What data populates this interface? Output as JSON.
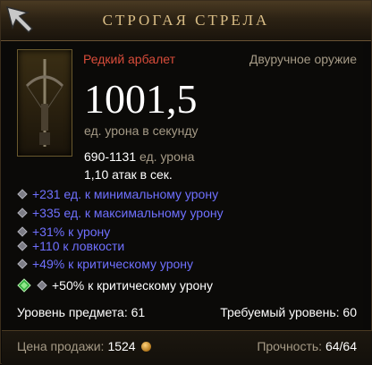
{
  "header": {
    "title": "СТРОГАЯ СТРЕЛА"
  },
  "item": {
    "rarity_type": "Редкий арбалет",
    "slot": "Двуручное оружие",
    "dps_value": "1001,5",
    "dps_label": "ед. урона в секунду",
    "damage_range": "690-1131",
    "damage_unit": "ед. урона",
    "attack_speed_value": "1,10",
    "attack_speed_unit": "атак в сек.",
    "affixes": [
      "+231 ед. к минимальному урону",
      "+335 ед. к максимальному урону",
      "+31% к урону",
      "+110 к ловкости",
      "+49% к критическому урону"
    ],
    "socket_bonus": "+50% к критическому урону",
    "item_level": "Уровень предмета: 61",
    "required_level": "Требуемый уровень: 60",
    "sell_price_label": "Цена продажи:",
    "sell_price_value": "1524",
    "durability_label": "Прочность:",
    "durability_value": "64/64"
  },
  "colors": {
    "title": "#d9bd86",
    "rarity": "#d94c3a",
    "affix": "#6f70ff",
    "muted": "#a59a86"
  },
  "icons": {
    "cursor": "arrow-cursor-icon",
    "weapon": "crossbow-icon",
    "gem": "emerald-gem-icon",
    "currency": "gold-coin-icon"
  }
}
